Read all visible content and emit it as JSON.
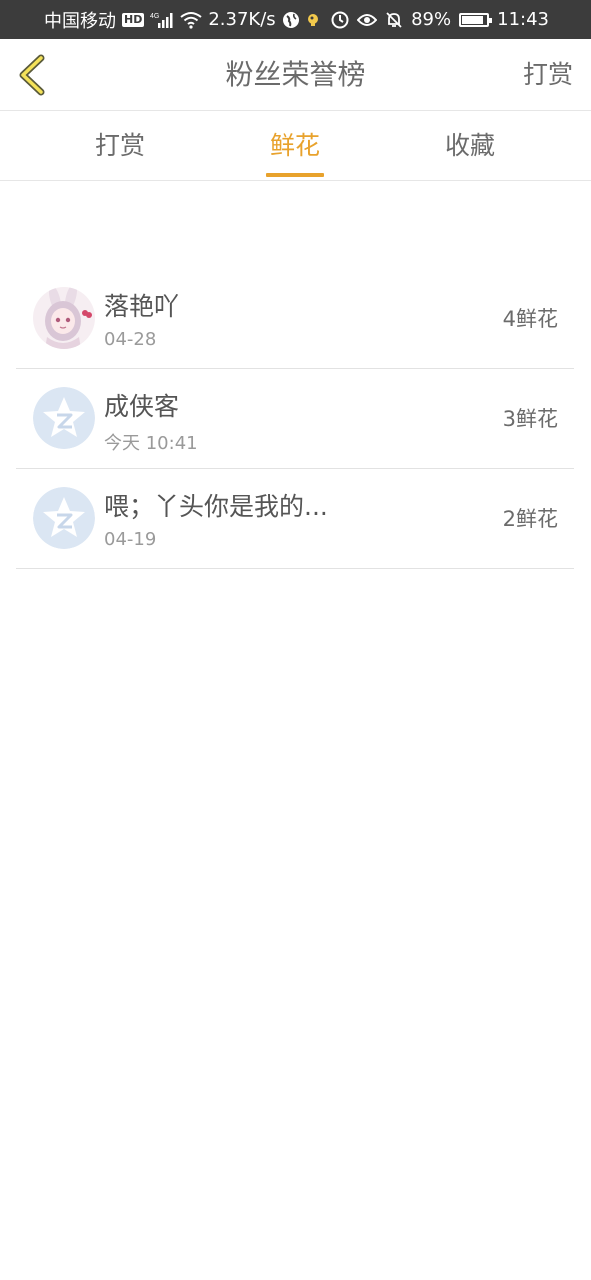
{
  "status_bar": {
    "carrier": "中国移动",
    "hd": "HD",
    "network": "4G",
    "speed": "2.37K/s",
    "battery_percent": "89%",
    "battery_level": 0.89,
    "time": "11:43",
    "icons": [
      "signal-icon",
      "wifi-icon",
      "globe-icon",
      "notification-icon",
      "data-saver-icon",
      "eye-icon",
      "mute-icon",
      "battery-icon"
    ]
  },
  "header": {
    "back_icon": "chevron-left-icon",
    "title": "粉丝荣誉榜",
    "action": "打赏",
    "accent": "#e8a22c"
  },
  "tabs": [
    {
      "label": "打赏",
      "active": false
    },
    {
      "label": "鲜花",
      "active": true
    },
    {
      "label": "收藏",
      "active": false
    }
  ],
  "list": [
    {
      "name": "落艳吖",
      "time": "04-28",
      "count": "4鲜花",
      "avatar": "anime-girl-avatar"
    },
    {
      "name": "成侠客",
      "time": "今天 10:41",
      "count": "3鲜花",
      "avatar": "default-qq-avatar"
    },
    {
      "name": "喂；丫头你是我的...",
      "time": "04-19",
      "count": "2鲜花",
      "avatar": "default-qq-avatar"
    }
  ]
}
